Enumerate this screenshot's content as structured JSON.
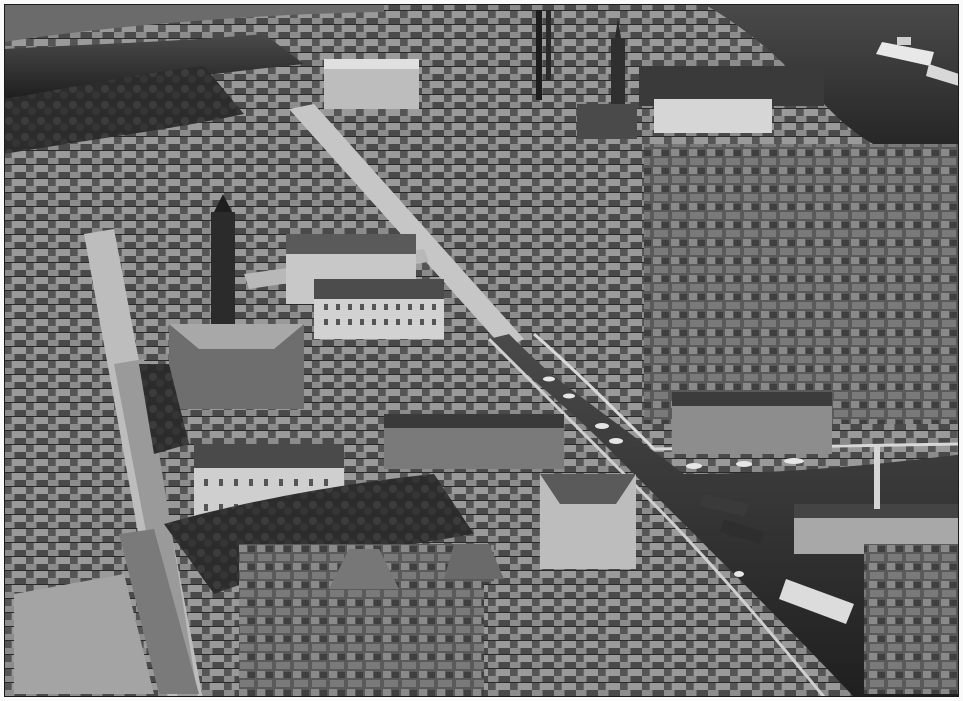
{
  "image": {
    "kind": "photograph",
    "tone": "black-and-white",
    "view": "aerial",
    "colors": {
      "paper": "#fafafa",
      "water": "#2c2c2c",
      "rooftop_dark": "#3d3d3d",
      "rooftop_light": "#9a9a9a",
      "street": "#c8c8c8",
      "foliage": "#262626"
    }
  }
}
